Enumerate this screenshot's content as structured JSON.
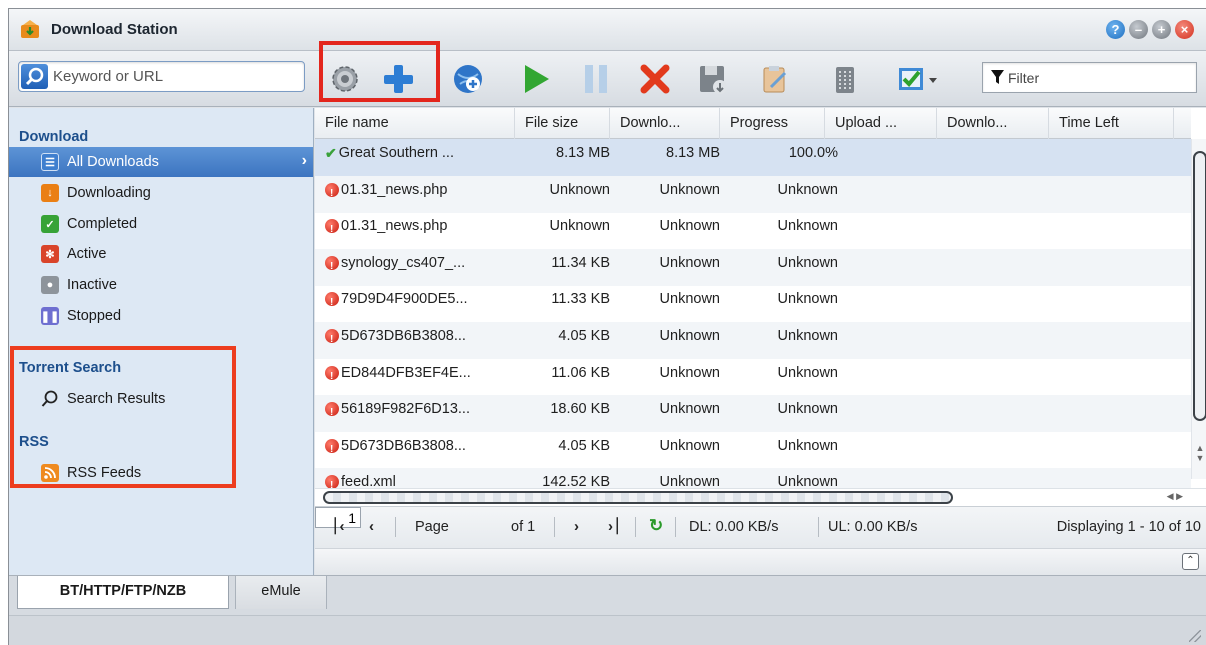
{
  "window": {
    "title": "Download Station",
    "buttons": [
      "help-icon",
      "minimize-icon",
      "maximize-icon",
      "close-icon"
    ]
  },
  "toolbar": {
    "search_placeholder": "Keyword or URL",
    "filter_placeholder": "Filter",
    "icons": [
      "settings-icon",
      "add-icon",
      "add-url-icon",
      "resume-icon",
      "pause-icon",
      "delete-icon",
      "save-icon",
      "edit-icon",
      "clear-completed-icon",
      "select-icon"
    ]
  },
  "sidebar": {
    "download_title": "Download",
    "items": [
      {
        "label": "All Downloads",
        "icon": "list-icon"
      },
      {
        "label": "Downloading",
        "icon": "downloading-icon"
      },
      {
        "label": "Completed",
        "icon": "completed-icon"
      },
      {
        "label": "Active",
        "icon": "active-icon"
      },
      {
        "label": "Inactive",
        "icon": "inactive-icon"
      },
      {
        "label": "Stopped",
        "icon": "stopped-icon"
      }
    ],
    "torrent_title": "Torrent Search",
    "search_results": "Search Results",
    "rss_title": "RSS",
    "rss_feeds": "RSS Feeds"
  },
  "grid": {
    "columns": [
      "File name",
      "File size",
      "Downlo...",
      "Progress",
      "Upload ...",
      "Downlo...",
      "Time Left"
    ],
    "rows": [
      {
        "name": "Great Southern ...",
        "size": "8.13 MB",
        "downloaded": "8.13 MB",
        "progress": "100.0%",
        "status": "ok"
      },
      {
        "name": "01.31_news.php",
        "size": "Unknown",
        "downloaded": "Unknown",
        "progress": "Unknown",
        "status": "error"
      },
      {
        "name": "01.31_news.php",
        "size": "Unknown",
        "downloaded": "Unknown",
        "progress": "Unknown",
        "status": "error"
      },
      {
        "name": "synology_cs407_...",
        "size": "11.34 KB",
        "downloaded": "Unknown",
        "progress": "Unknown",
        "status": "error"
      },
      {
        "name": "79D9D4F900DE5...",
        "size": "11.33 KB",
        "downloaded": "Unknown",
        "progress": "Unknown",
        "status": "error"
      },
      {
        "name": "5D673DB6B3808...",
        "size": "4.05 KB",
        "downloaded": "Unknown",
        "progress": "Unknown",
        "status": "error"
      },
      {
        "name": "ED844DFB3EF4E...",
        "size": "11.06 KB",
        "downloaded": "Unknown",
        "progress": "Unknown",
        "status": "error"
      },
      {
        "name": "56189F982F6D13...",
        "size": "18.60 KB",
        "downloaded": "Unknown",
        "progress": "Unknown",
        "status": "error"
      },
      {
        "name": "5D673DB6B3808...",
        "size": "4.05 KB",
        "downloaded": "Unknown",
        "progress": "Unknown",
        "status": "error"
      },
      {
        "name": "feed.xml",
        "size": "142.52 KB",
        "downloaded": "Unknown",
        "progress": "Unknown",
        "status": "error"
      }
    ]
  },
  "pager": {
    "page_label": "Page",
    "page_value": "1",
    "of_label": "of 1",
    "dl_speed": "DL: 0.00 KB/s",
    "ul_speed": "UL: 0.00 KB/s",
    "display_info": "Displaying 1 - 10 of 10"
  },
  "tabs": {
    "active": "BT/HTTP/FTP/NZB",
    "inactive": "eMule"
  },
  "colors": {
    "highlight_box": "#e3261d",
    "selection": "#3c74c0",
    "section_title": "#1d4f8c"
  }
}
